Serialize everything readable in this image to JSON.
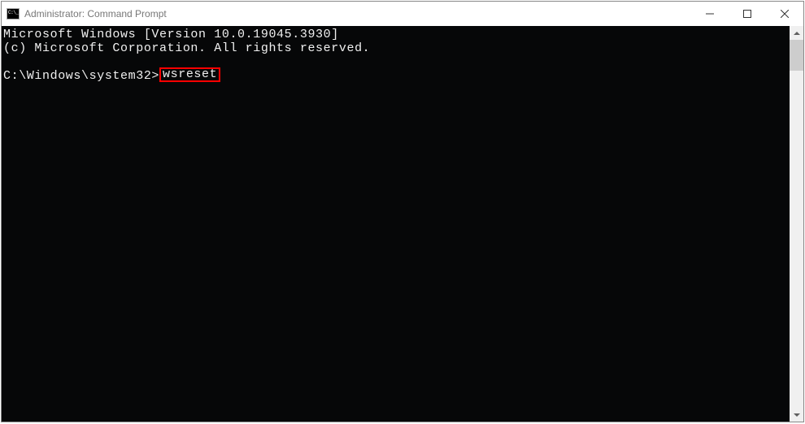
{
  "window": {
    "title": "Administrator: Command Prompt"
  },
  "terminal": {
    "line1": "Microsoft Windows [Version 10.0.19045.3930]",
    "line2": "(c) Microsoft Corporation. All rights reserved.",
    "prompt": "C:\\Windows\\system32>",
    "command": "wsreset"
  }
}
